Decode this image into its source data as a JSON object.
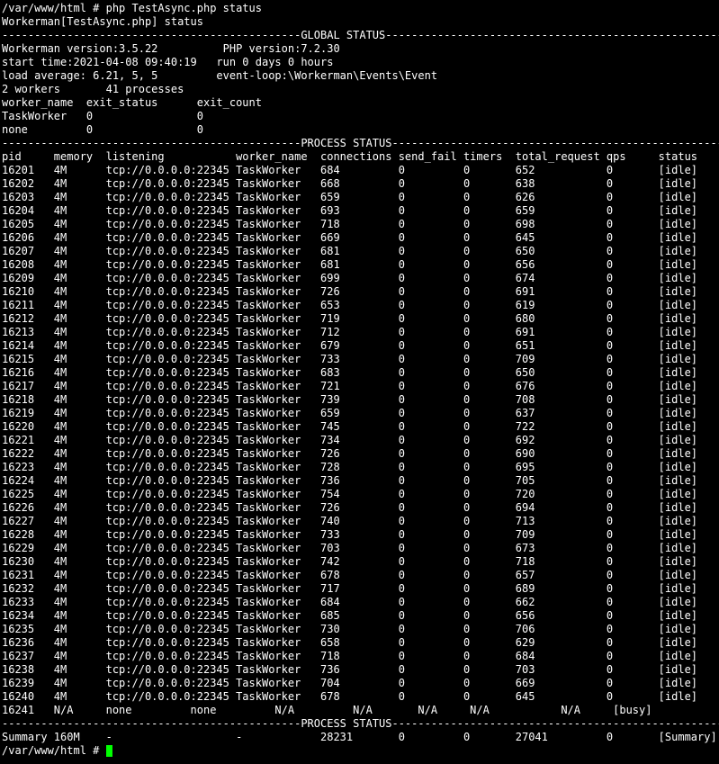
{
  "terminal": {
    "lines": [
      "/var/www/html # php TestAsync.php status",
      "Workerman[TestAsync.php] status",
      "----------------------------------------------GLOBAL STATUS----------------------------------------------------",
      "Workerman version:3.5.22          PHP version:7.2.30",
      "start time:2021-04-08 09:40:19   run 0 days 0 hours",
      "load average: 6.21, 5, 5         event-loop:\\Workerman\\Events\\Event",
      "2 workers       41 processes",
      "worker_name  exit_status      exit_count",
      "TaskWorker   0                0",
      "none         0                0",
      "----------------------------------------------PROCESS STATUS---------------------------------------------------",
      "pid     memory  listening           worker_name  connections send_fail timers  total_request qps     status",
      "16201   4M      tcp://0.0.0.0:22345 TaskWorker   684         0         0       652           0       [idle]",
      "16202   4M      tcp://0.0.0.0:22345 TaskWorker   668         0         0       638           0       [idle]",
      "16203   4M      tcp://0.0.0.0:22345 TaskWorker   659         0         0       626           0       [idle]",
      "16204   4M      tcp://0.0.0.0:22345 TaskWorker   693         0         0       659           0       [idle]",
      "16205   4M      tcp://0.0.0.0:22345 TaskWorker   718         0         0       698           0       [idle]",
      "16206   4M      tcp://0.0.0.0:22345 TaskWorker   669         0         0       645           0       [idle]",
      "16207   4M      tcp://0.0.0.0:22345 TaskWorker   681         0         0       650           0       [idle]",
      "16208   4M      tcp://0.0.0.0:22345 TaskWorker   681         0         0       656           0       [idle]",
      "16209   4M      tcp://0.0.0.0:22345 TaskWorker   699         0         0       674           0       [idle]",
      "16210   4M      tcp://0.0.0.0:22345 TaskWorker   726         0         0       691           0       [idle]",
      "16211   4M      tcp://0.0.0.0:22345 TaskWorker   653         0         0       619           0       [idle]",
      "16212   4M      tcp://0.0.0.0:22345 TaskWorker   719         0         0       680           0       [idle]",
      "16213   4M      tcp://0.0.0.0:22345 TaskWorker   712         0         0       691           0       [idle]",
      "16214   4M      tcp://0.0.0.0:22345 TaskWorker   679         0         0       651           0       [idle]",
      "16215   4M      tcp://0.0.0.0:22345 TaskWorker   733         0         0       709           0       [idle]",
      "16216   4M      tcp://0.0.0.0:22345 TaskWorker   683         0         0       650           0       [idle]",
      "16217   4M      tcp://0.0.0.0:22345 TaskWorker   721         0         0       676           0       [idle]",
      "16218   4M      tcp://0.0.0.0:22345 TaskWorker   739         0         0       708           0       [idle]",
      "16219   4M      tcp://0.0.0.0:22345 TaskWorker   659         0         0       637           0       [idle]",
      "16220   4M      tcp://0.0.0.0:22345 TaskWorker   745         0         0       722           0       [idle]",
      "16221   4M      tcp://0.0.0.0:22345 TaskWorker   734         0         0       692           0       [idle]",
      "16222   4M      tcp://0.0.0.0:22345 TaskWorker   726         0         0       690           0       [idle]",
      "16223   4M      tcp://0.0.0.0:22345 TaskWorker   728         0         0       695           0       [idle]",
      "16224   4M      tcp://0.0.0.0:22345 TaskWorker   736         0         0       705           0       [idle]",
      "16225   4M      tcp://0.0.0.0:22345 TaskWorker   754         0         0       720           0       [idle]",
      "16226   4M      tcp://0.0.0.0:22345 TaskWorker   726         0         0       694           0       [idle]",
      "16227   4M      tcp://0.0.0.0:22345 TaskWorker   740         0         0       713           0       [idle]",
      "16228   4M      tcp://0.0.0.0:22345 TaskWorker   733         0         0       709           0       [idle]",
      "16229   4M      tcp://0.0.0.0:22345 TaskWorker   703         0         0       673           0       [idle]",
      "16230   4M      tcp://0.0.0.0:22345 TaskWorker   742         0         0       718           0       [idle]",
      "16231   4M      tcp://0.0.0.0:22345 TaskWorker   678         0         0       657           0       [idle]",
      "16232   4M      tcp://0.0.0.0:22345 TaskWorker   717         0         0       689           0       [idle]",
      "16233   4M      tcp://0.0.0.0:22345 TaskWorker   684         0         0       662           0       [idle]",
      "16234   4M      tcp://0.0.0.0:22345 TaskWorker   685         0         0       656           0       [idle]",
      "16235   4M      tcp://0.0.0.0:22345 TaskWorker   730         0         0       706           0       [idle]",
      "16236   4M      tcp://0.0.0.0:22345 TaskWorker   658         0         0       629           0       [idle]",
      "16237   4M      tcp://0.0.0.0:22345 TaskWorker   718         0         0       684           0       [idle]",
      "16238   4M      tcp://0.0.0.0:22345 TaskWorker   736         0         0       703           0       [idle]",
      "16239   4M      tcp://0.0.0.0:22345 TaskWorker   704         0         0       669           0       [idle]",
      "16240   4M      tcp://0.0.0.0:22345 TaskWorker   678         0         0       645           0       [idle]",
      "16241   N/A     none         none         N/A         N/A       N/A     N/A           N/A     [busy]",
      "----------------------------------------------PROCESS STATUS---------------------------------------------------",
      "Summary 160M    -                   -            28231       0         0       27041         0       [Summary]"
    ],
    "prompt": "/var/www/html # ",
    "cursor_color": "#00ff00",
    "text_color": "#ffffff",
    "background_color": "#000000"
  }
}
